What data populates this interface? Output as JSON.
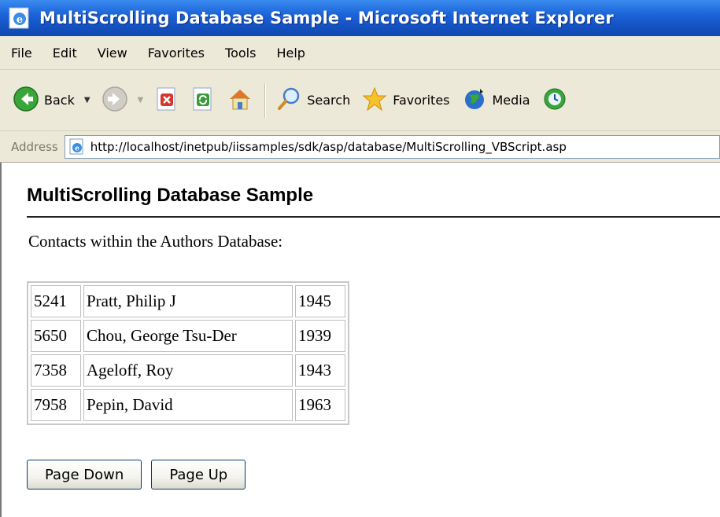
{
  "window": {
    "title": "MultiScrolling Database Sample - Microsoft Internet Explorer"
  },
  "menu": [
    "File",
    "Edit",
    "View",
    "Favorites",
    "Tools",
    "Help"
  ],
  "toolbar": {
    "back_label": "Back",
    "search_label": "Search",
    "favorites_label": "Favorites",
    "media_label": "Media"
  },
  "address": {
    "label": "Address",
    "url": "http://localhost/inetpub/iissamples/sdk/asp/database/MultiScrolling_VBScript.asp"
  },
  "page": {
    "heading": "MultiScrolling Database Sample",
    "intro": "Contacts within the Authors Database:",
    "rows": [
      {
        "id": "5241",
        "name": "Pratt, Philip J",
        "year": "1945"
      },
      {
        "id": "5650",
        "name": "Chou, George Tsu-Der",
        "year": "1939"
      },
      {
        "id": "7358",
        "name": "Ageloff, Roy",
        "year": "1943"
      },
      {
        "id": "7958",
        "name": "Pepin, David",
        "year": "1963"
      }
    ],
    "page_down_label": "Page Down",
    "page_up_label": "Page Up"
  },
  "colors": {
    "titlebar": "#1c63d8",
    "chrome": "#ece9d8"
  },
  "icons": [
    "ie-logo-icon",
    "back-arrow-icon",
    "forward-arrow-icon",
    "stop-icon",
    "refresh-icon",
    "home-icon",
    "search-magnifier-icon",
    "favorites-star-icon",
    "media-globe-icon",
    "history-icon",
    "page-icon"
  ]
}
